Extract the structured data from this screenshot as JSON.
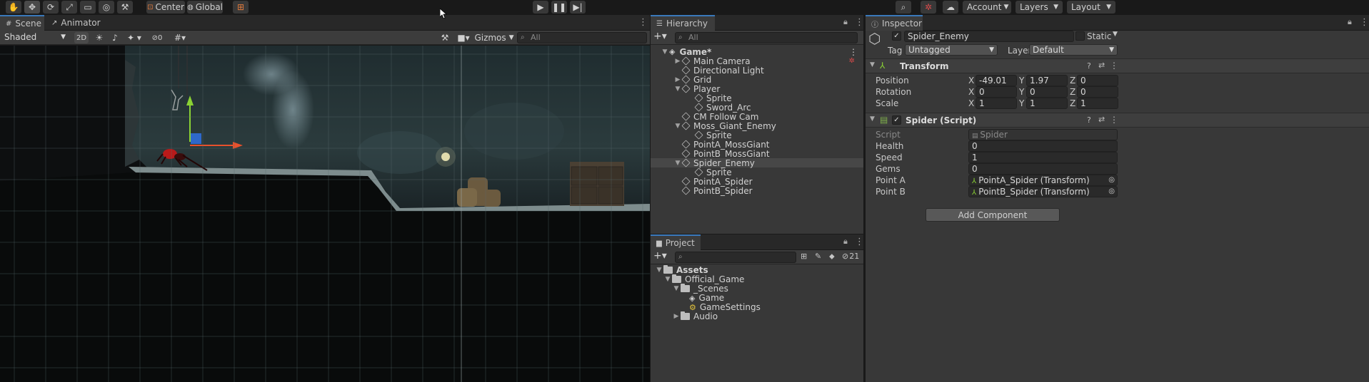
{
  "toolbar": {
    "tools": [
      "hand-tool",
      "move-tool",
      "rotate-tool",
      "scale-tool",
      "rect-tool",
      "transform-tool",
      "custom-tool"
    ],
    "pivot_mode": "Center",
    "pivot_rotation": "Global",
    "account": "Account",
    "layers": "Layers",
    "layout": "Layout"
  },
  "scene_panel": {
    "tabs": [
      "Scene",
      "Animator"
    ],
    "shading": "Shaded",
    "mode_2d": "2D",
    "hidden_count": "0",
    "gizmos": "Gizmos",
    "search_placeholder": "All"
  },
  "hierarchy": {
    "tab": "Hierarchy",
    "search_placeholder": "All",
    "items": [
      {
        "label": "Game*",
        "depth": 0,
        "expanded": true,
        "scene": true
      },
      {
        "label": "Main Camera",
        "depth": 1,
        "expanded": false,
        "has_children": true
      },
      {
        "label": "Directional Light",
        "depth": 1
      },
      {
        "label": "Grid",
        "depth": 1,
        "has_children": true,
        "expanded": false
      },
      {
        "label": "Player",
        "depth": 1,
        "has_children": true,
        "expanded": true
      },
      {
        "label": "Sprite",
        "depth": 2
      },
      {
        "label": "Sword_Arc",
        "depth": 2
      },
      {
        "label": "CM Follow Cam",
        "depth": 1
      },
      {
        "label": "Moss_Giant_Enemy",
        "depth": 1,
        "has_children": true,
        "expanded": true
      },
      {
        "label": "Sprite",
        "depth": 2
      },
      {
        "label": "PointA_MossGiant",
        "depth": 1
      },
      {
        "label": "PointB_MossGiant",
        "depth": 1
      },
      {
        "label": "Spider_Enemy",
        "depth": 1,
        "has_children": true,
        "expanded": true,
        "selected": true
      },
      {
        "label": "Sprite",
        "depth": 2
      },
      {
        "label": "PointA_Spider",
        "depth": 1
      },
      {
        "label": "PointB_Spider",
        "depth": 1
      }
    ]
  },
  "project": {
    "tab": "Project",
    "hidden_count": "21",
    "items": [
      {
        "label": "Assets",
        "depth": 0,
        "type": "folder",
        "bold": true
      },
      {
        "label": "Official_Game",
        "depth": 1,
        "type": "folder"
      },
      {
        "label": "_Scenes",
        "depth": 2,
        "type": "folder"
      },
      {
        "label": "Game",
        "depth": 3,
        "type": "scene"
      },
      {
        "label": "GameSettings",
        "depth": 3,
        "type": "settings"
      },
      {
        "label": "Audio",
        "depth": 2,
        "type": "folder"
      }
    ]
  },
  "inspector": {
    "tab": "Inspector",
    "object_name": "Spider_Enemy",
    "static_label": "Static",
    "tag_label": "Tag",
    "tag_value": "Untagged",
    "layer_label": "Layer",
    "layer_value": "Default",
    "transform": {
      "title": "Transform",
      "rows": [
        {
          "label": "Position",
          "x": "-49.01",
          "y": "1.97",
          "z": "0"
        },
        {
          "label": "Rotation",
          "x": "0",
          "y": "0",
          "z": "0"
        },
        {
          "label": "Scale",
          "x": "1",
          "y": "1",
          "z": "1"
        }
      ]
    },
    "script_component": {
      "title": "Spider (Script)",
      "script_label": "Script",
      "script_value": "Spider",
      "fields": [
        {
          "label": "Health",
          "value": "0"
        },
        {
          "label": "Speed",
          "value": "1"
        },
        {
          "label": "Gems",
          "value": "0"
        },
        {
          "label": "Point A",
          "value": "PointA_Spider (Transform)"
        },
        {
          "label": "Point B",
          "value": "PointB_Spider (Transform)"
        }
      ]
    },
    "add_component": "Add Component"
  },
  "colors": {
    "accent": "#3a79bb",
    "selection": "#474747",
    "gizmo_x": "#e8512c",
    "gizmo_y": "#8ad234",
    "gizmo_z": "#2f6ed9"
  }
}
